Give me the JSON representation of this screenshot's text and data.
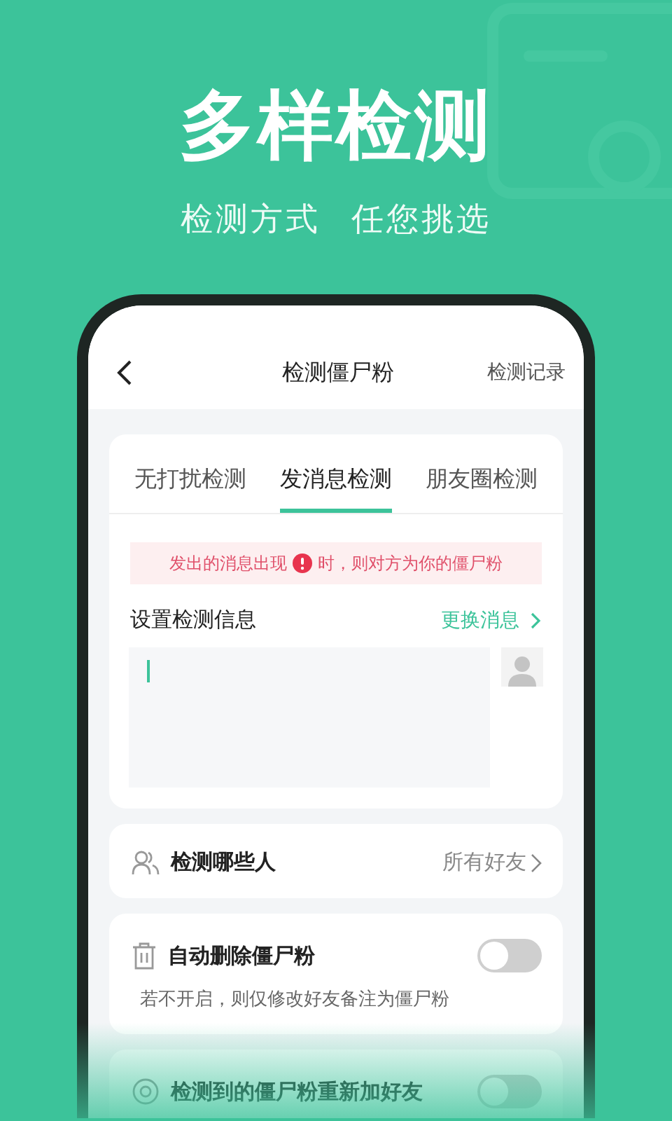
{
  "hero": {
    "title": "多样检测",
    "subtitle": [
      "检测方式",
      "任您挑选"
    ]
  },
  "nav": {
    "title": "检测僵尸粉",
    "action": "检测记录"
  },
  "tabs": [
    {
      "label": "无打扰检测",
      "selected": false
    },
    {
      "label": "发消息检测",
      "selected": true
    },
    {
      "label": "朋友圈检测",
      "selected": false
    }
  ],
  "notice": {
    "before": "发出的消息出现",
    "after": "时，则对方为你的僵尸粉"
  },
  "message": {
    "label": "设置检测信息",
    "change": "更换消息"
  },
  "settings": [
    {
      "kind": "link",
      "label": "检测哪些人",
      "value": "所有好友"
    },
    {
      "kind": "toggle",
      "label": "自动删除僵尸粉",
      "description": "若不开启，则仅修改好友备注为僵尸粉",
      "on": false
    },
    {
      "kind": "toggle",
      "label": "检测到的僵尸粉重新加好友",
      "on": false
    }
  ]
}
